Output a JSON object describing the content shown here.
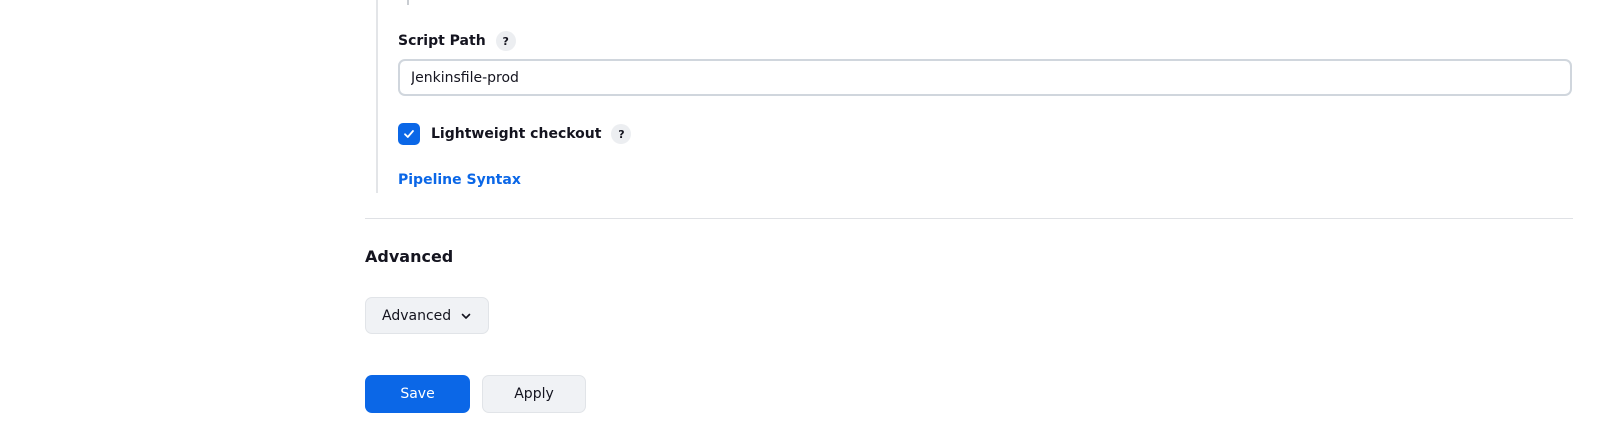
{
  "script_path": {
    "label": "Script Path",
    "help": "?",
    "value": "Jenkinsfile-prod"
  },
  "lightweight_checkout": {
    "label": "Lightweight checkout",
    "help": "?",
    "checked": true
  },
  "pipeline_syntax_link": "Pipeline Syntax",
  "advanced_section": {
    "heading": "Advanced",
    "dropdown_label": "Advanced"
  },
  "actions": {
    "save_label": "Save",
    "apply_label": "Apply"
  },
  "colors": {
    "accent": "#0b67e7",
    "secondary_bg": "#f0f2f5",
    "text": "#14141f"
  },
  "icons": {
    "checkbox": "check-icon",
    "dropdown": "chevron-down-icon"
  }
}
